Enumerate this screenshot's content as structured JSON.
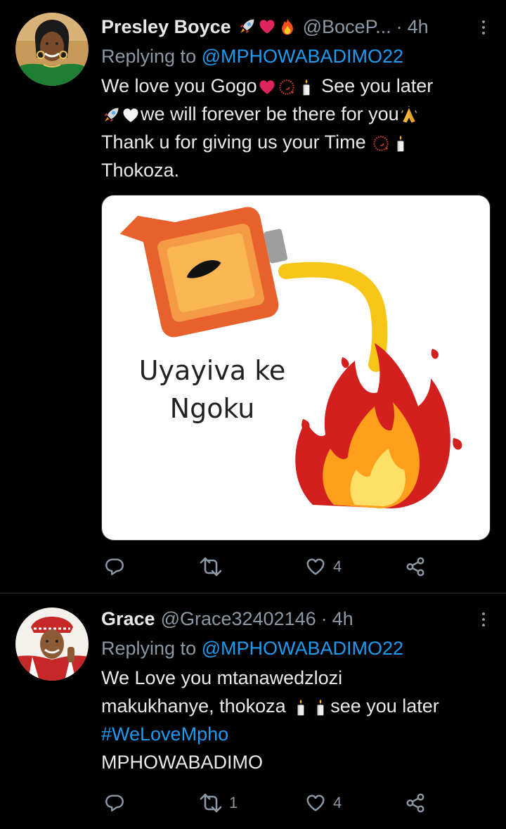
{
  "tweets": [
    {
      "name": "Presley Boyce",
      "name_emojis": [
        "rocket-emoji",
        "red-heart-emoji",
        "fire-emoji"
      ],
      "handle": "@BoceP...",
      "time": "4h",
      "replying_label": "Replying to ",
      "replying_to": "@MPHOWABADIMO22",
      "body_lines": [
        "We love you Gogo",
        "See you later",
        "we will forever be there for you",
        "Thank u for giving us your Time",
        "Thokoza."
      ],
      "media": {
        "caption_line1": "Uyayiva ke",
        "caption_line2": "Ngoku"
      },
      "actions": {
        "replies": "",
        "retweets": "",
        "likes": "4"
      }
    },
    {
      "name": "Grace",
      "handle": "@Grace32402146",
      "time": "4h",
      "replying_label": "Replying to ",
      "replying_to": "@MPHOWABADIMO22",
      "body_lines": [
        "We Love you mtanawedzlozi",
        "makukhanye, thokoza",
        "see you later",
        "#WeLoveMpho",
        "MPHOWABADIMO"
      ],
      "actions": {
        "replies": "",
        "retweets": "1",
        "likes": "4"
      }
    }
  ],
  "icons": {
    "reply": "reply-icon",
    "retweet": "retweet-icon",
    "like": "heart-icon",
    "share": "share-icon",
    "more": "more-options-icon"
  },
  "colors": {
    "link": "#1d9bf0",
    "muted": "#8b98a5",
    "text": "#e7e9ea",
    "background": "#000000"
  }
}
